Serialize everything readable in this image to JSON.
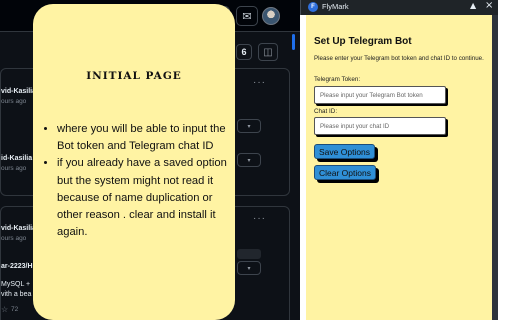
{
  "background": {
    "count_badge": "6",
    "card1": {
      "author": "vid-Kasilia",
      "time": "ours ago",
      "author2": "id-Kasilia",
      "time2": "ours ago"
    },
    "card2": {
      "author": "vid-Kasilia",
      "time": "ours ago",
      "repo": "ar-2223/H",
      "line1": "MySQL +",
      "line2": "vith a bea",
      "stars": "72"
    }
  },
  "onboarding": {
    "title": "INITIAL PAGE",
    "bullets": [
      "where you will be able to input the Bot token and Telegram chat ID",
      "if you already have a saved option but the system might not read it because of name duplication or other reason . clear and install it again."
    ]
  },
  "extension": {
    "name": "FlyMark",
    "heading": "Set Up Telegram Bot",
    "description": "Please enter your Telegram bot token and chat ID to continue.",
    "token_label": "Telegram Token:",
    "token_placeholder": "Please input your Telegram Bot token",
    "chat_label": "Chat ID:",
    "chat_placeholder": "Please input your chat ID",
    "save_button": "Save Options",
    "clear_button": "Clear Options"
  },
  "colors": {
    "card_background": "#fff3a3",
    "button_background": "#2f8fd6",
    "dark_background": "#0d1117"
  },
  "icons": [
    "inbox-icon",
    "avatar",
    "panel-icon",
    "kebab-icon",
    "star-icon",
    "pin-icon",
    "close-icon",
    "flymark-logo"
  ]
}
